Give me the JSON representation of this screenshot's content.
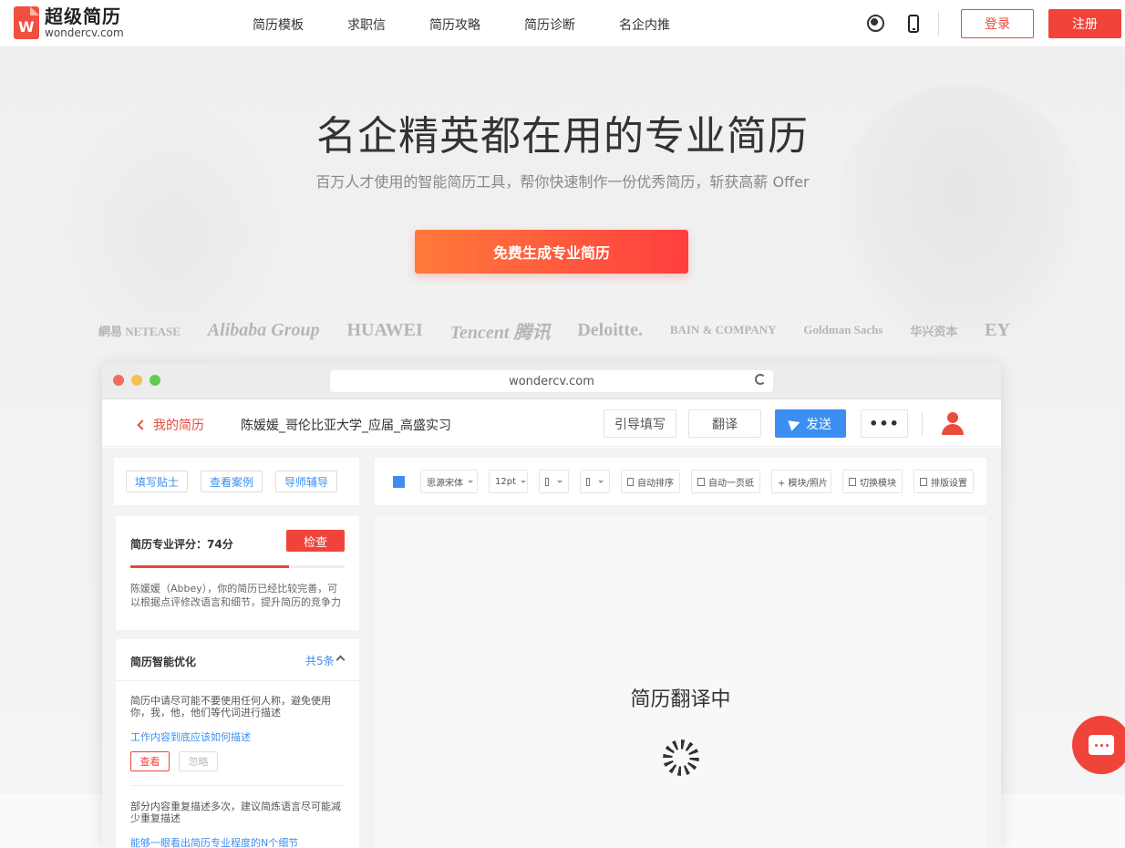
{
  "header": {
    "logo_name": "超级简历",
    "logo_url": "wondercv.com",
    "nav": [
      "简历模板",
      "求职信",
      "简历攻略",
      "简历诊断",
      "名企内推"
    ],
    "login_label": "登录",
    "register_label": "注册"
  },
  "hero": {
    "title": "名企精英都在用的专业简历",
    "subtitle": "百万人才使用的智能简历工具，帮你快速制作一份优秀简历，斩获高薪 Offer",
    "cta_label": "免费生成专业简历",
    "brands": [
      "網易 NETEASE",
      "Alibaba Group",
      "HUAWEI",
      "Tencent 腾讯",
      "Deloitte.",
      "BAIN & COMPANY",
      "Goldman Sachs",
      "华兴资本",
      "EY"
    ]
  },
  "browser": {
    "url": "wondercv.com"
  },
  "app": {
    "back_label": "我的简历",
    "doc_title": "陈媛媛_哥伦比亚大学_应届_高盛实习",
    "guide_label": "引导填写",
    "translate_label": "翻译",
    "send_label": "发送",
    "more_label": "•••",
    "side_tabs": [
      "填写贴士",
      "查看案例",
      "导师辅导"
    ],
    "score": {
      "label": "简历专业评分：74分",
      "value": 74,
      "check_label": "检查",
      "desc": "陈媛媛（Abbey），你的简历已经比较完善，可以根据点评修改语言和细节，提升简历的竞争力"
    },
    "optimize": {
      "title": "简历智能优化",
      "count": "共5条",
      "tip1": "简历中请尽可能不要使用任何人称，避免使用你，我，他，他们等代词进行描述",
      "tip1_link": "工作内容到底应该如何描述",
      "view_label": "查看",
      "ignore_label": "忽略",
      "tip2": "部分内容重复描述多次，建议简炼语言尽可能减少重复描述",
      "tip2_link": "能够一眼看出简历专业程度的N个细节"
    },
    "toolbar": {
      "font": "思源宋体",
      "size": "12pt",
      "auto_sort": "自动排序",
      "one_page": "自动一页纸",
      "module_photo": "+ 模块/照片",
      "switch_module": "切换模块",
      "layout": "排版设置"
    },
    "preview_text": "简历翻译中"
  },
  "colors": {
    "accent": "#f0443a",
    "blue": "#3b8ff2"
  }
}
